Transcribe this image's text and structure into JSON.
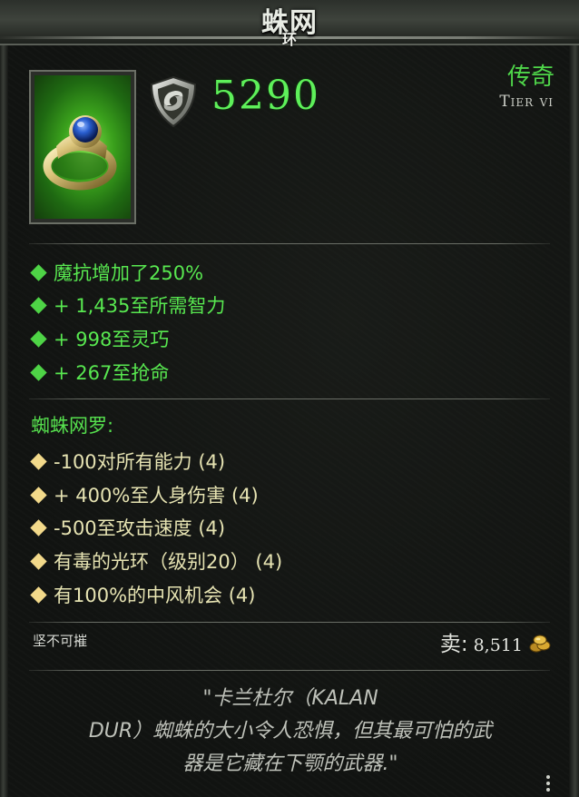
{
  "item": {
    "name": "蛛网",
    "type": "环",
    "armor": "5290",
    "rarity": "传奇",
    "tier": "Tier vi"
  },
  "stats": [
    {
      "text": "魔抗增加了250%"
    },
    {
      "text": "+ 1,435至所需智力"
    },
    {
      "text": "+ 998至灵巧"
    },
    {
      "text": "+ 267至抢命"
    }
  ],
  "set": {
    "title": "蜘蛛网罗:",
    "bonuses": [
      {
        "text": "-100对所有能力 (4)"
      },
      {
        "text": "+ 400%至人身伤害 (4)"
      },
      {
        "text": "-500至攻击速度 (4)"
      },
      {
        "text": "有毒的光环（级别20） (4)"
      },
      {
        "text": "有100%的中风机会 (4)"
      }
    ]
  },
  "footer": {
    "unbreakable": "坚不可摧",
    "sell_label": "卖:",
    "sell_value": "8,511"
  },
  "flavor": {
    "line1": "\"卡兰杜尔（KALAN",
    "line2": "DUR）蜘蛛的大小令人恐惧，但其最可怕的武",
    "line3": "器是它藏在下颚的武器.\""
  },
  "icons": {
    "armor": "shield-swirl-icon",
    "item": "ring-icon",
    "gold": "gold-coins-icon"
  },
  "colors": {
    "legendary_green": "#58e850",
    "set_yellow": "#f2d98a",
    "set_text": "#e6e3b2"
  }
}
